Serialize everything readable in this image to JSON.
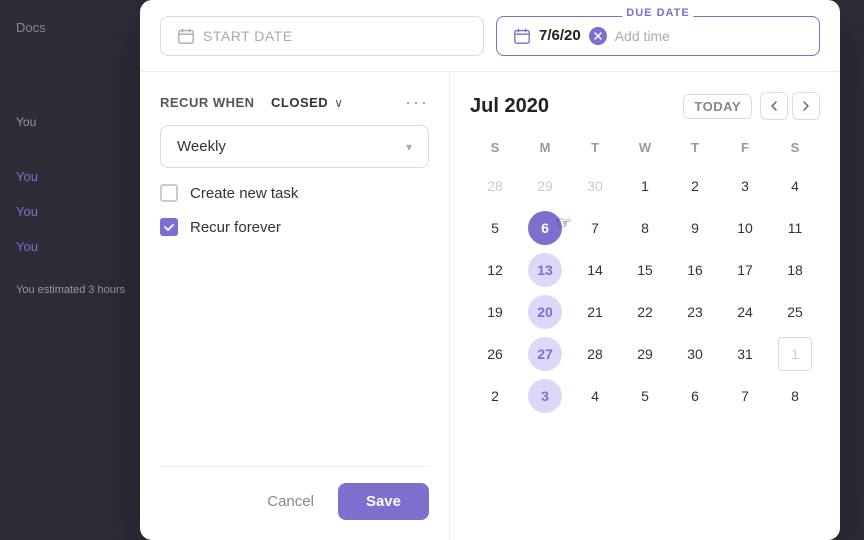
{
  "background": {
    "items": [
      "Docs",
      "You",
      "You",
      "You",
      "You estimated 3 hours"
    ]
  },
  "header": {
    "start_date_placeholder": "START DATE",
    "due_date_label": "DUE DATE",
    "due_date_value": "7/6/20",
    "add_time_label": "Add time"
  },
  "left_panel": {
    "recur_label": "RECUR WHEN",
    "recur_bold": "CLOSED",
    "chevron": "∨",
    "more": "···",
    "frequency": {
      "value": "Weekly",
      "chevron": "▾"
    },
    "options": [
      {
        "id": "create-new-task",
        "label": "Create new task",
        "checked": false
      },
      {
        "id": "recur-forever",
        "label": "Recur forever",
        "checked": true
      }
    ],
    "cancel_label": "Cancel",
    "save_label": "Save"
  },
  "calendar": {
    "month_year": "Jul 2020",
    "today_label": "TODAY",
    "prev_arrow": "‹",
    "next_arrow": "›",
    "day_headers": [
      "S",
      "M",
      "T",
      "W",
      "T",
      "F",
      "S"
    ],
    "weeks": [
      [
        {
          "day": "28",
          "type": "other"
        },
        {
          "day": "29",
          "type": "other"
        },
        {
          "day": "30",
          "type": "other"
        },
        {
          "day": "1",
          "type": "normal"
        },
        {
          "day": "2",
          "type": "normal"
        },
        {
          "day": "3",
          "type": "normal"
        },
        {
          "day": "4",
          "type": "normal"
        }
      ],
      [
        {
          "day": "5",
          "type": "normal"
        },
        {
          "day": "6",
          "type": "today"
        },
        {
          "day": "7",
          "type": "normal"
        },
        {
          "day": "8",
          "type": "normal"
        },
        {
          "day": "9",
          "type": "normal"
        },
        {
          "day": "10",
          "type": "normal"
        },
        {
          "day": "11",
          "type": "normal"
        }
      ],
      [
        {
          "day": "12",
          "type": "normal"
        },
        {
          "day": "13",
          "type": "selected"
        },
        {
          "day": "14",
          "type": "normal"
        },
        {
          "day": "15",
          "type": "normal"
        },
        {
          "day": "16",
          "type": "normal"
        },
        {
          "day": "17",
          "type": "normal"
        },
        {
          "day": "18",
          "type": "normal"
        }
      ],
      [
        {
          "day": "19",
          "type": "normal"
        },
        {
          "day": "20",
          "type": "selected"
        },
        {
          "day": "21",
          "type": "normal"
        },
        {
          "day": "22",
          "type": "normal"
        },
        {
          "day": "23",
          "type": "normal"
        },
        {
          "day": "24",
          "type": "normal"
        },
        {
          "day": "25",
          "type": "normal"
        }
      ],
      [
        {
          "day": "26",
          "type": "normal"
        },
        {
          "day": "27",
          "type": "selected"
        },
        {
          "day": "28",
          "type": "normal"
        },
        {
          "day": "29",
          "type": "normal"
        },
        {
          "day": "30",
          "type": "normal"
        },
        {
          "day": "31",
          "type": "normal"
        },
        {
          "day": "1",
          "type": "other-highlight"
        }
      ],
      [
        {
          "day": "2",
          "type": "normal"
        },
        {
          "day": "3",
          "type": "selected"
        },
        {
          "day": "4",
          "type": "normal"
        },
        {
          "day": "5",
          "type": "normal"
        },
        {
          "day": "6",
          "type": "normal"
        },
        {
          "day": "7",
          "type": "normal"
        },
        {
          "day": "8",
          "type": "normal"
        }
      ]
    ]
  }
}
